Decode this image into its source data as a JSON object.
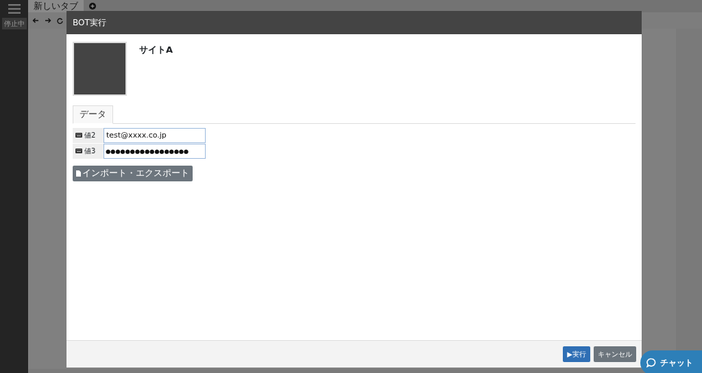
{
  "sidebar": {
    "status": "停止中"
  },
  "browser": {
    "tabs": [
      {
        "label": "新しいタブ"
      }
    ]
  },
  "modal": {
    "title": "BOT実行",
    "site_name": "サイトA",
    "tabs": [
      {
        "label": "データ",
        "selected": true
      }
    ],
    "fields": [
      {
        "label": "値2",
        "value": "test@xxxx.co.jp"
      },
      {
        "label": "値3",
        "value": "●●●●●●●●●●●●●●●●●"
      }
    ],
    "import_export_button": "インポート・エクスポート",
    "buttons": [
      {
        "label": "▶実行",
        "kind": "primary"
      },
      {
        "label": "キャンセル",
        "kind": "secondary"
      }
    ]
  },
  "chat_button": "チャット"
}
